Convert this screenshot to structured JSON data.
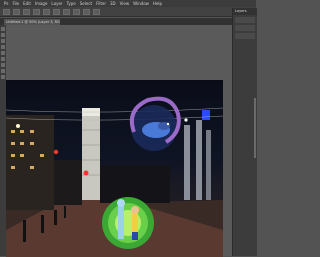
{
  "menubar": {
    "items": [
      "Ps",
      "File",
      "Edit",
      "Image",
      "Layer",
      "Type",
      "Select",
      "Filter",
      "3D",
      "View",
      "Window",
      "Help"
    ]
  },
  "tab": {
    "label": "Untitled-1 @ 50% (Layer 3, RGB/8)"
  },
  "panel": {
    "header": "Layers"
  },
  "colors": {
    "accent": "#31a8ff",
    "portal_green": "#3aa832",
    "sky": "#0d1222"
  },
  "icons": [
    "move-icon",
    "marquee-icon",
    "lasso-icon",
    "crop-icon",
    "brush-icon",
    "eraser-icon",
    "text-icon",
    "hand-icon",
    "zoom-icon"
  ]
}
